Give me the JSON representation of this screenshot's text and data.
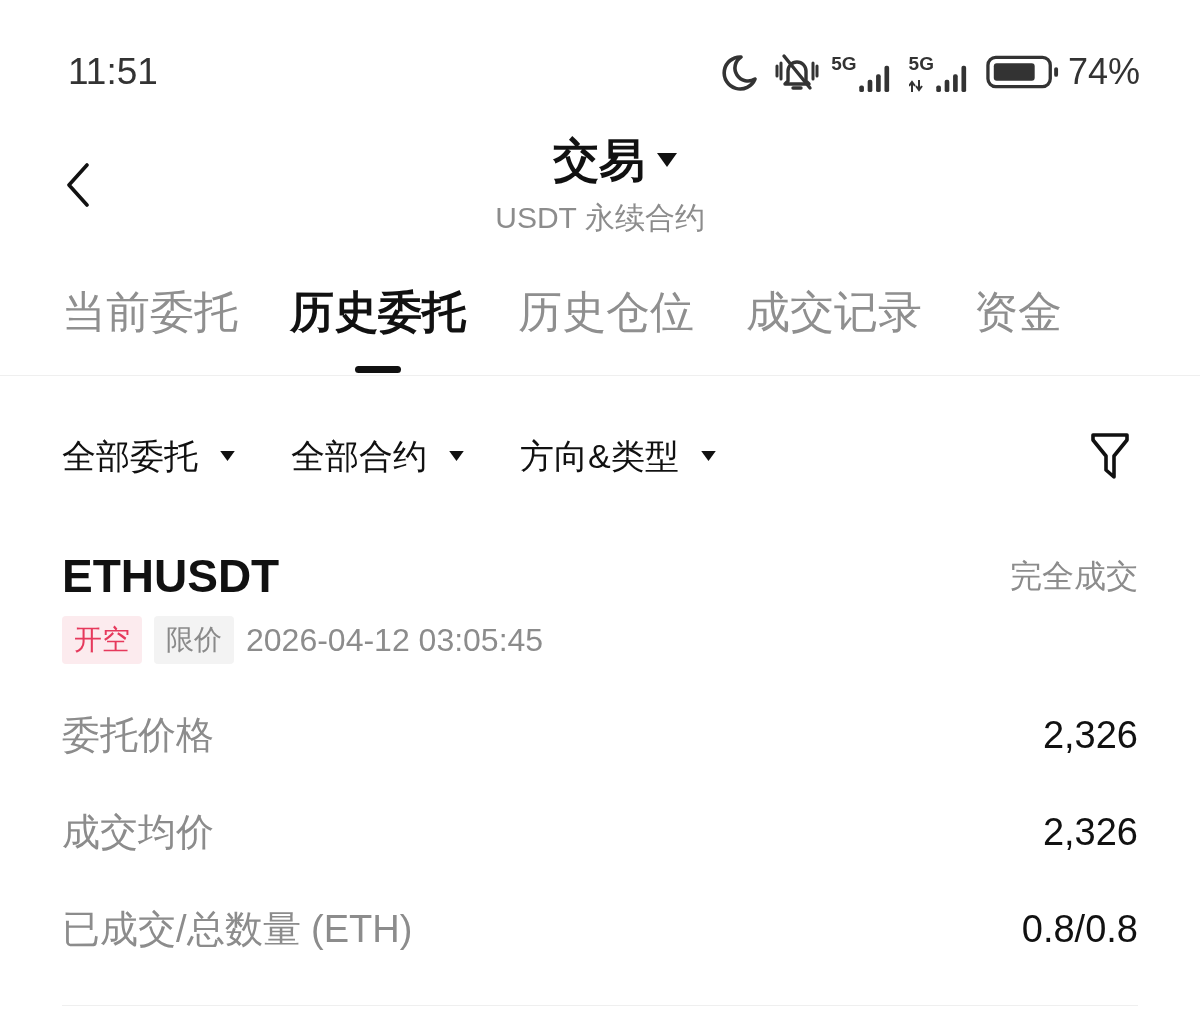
{
  "status_bar": {
    "time": "11:51",
    "networks": [
      {
        "label": "5G",
        "kind": "plain"
      },
      {
        "label": "5G",
        "kind": "transfer"
      }
    ],
    "battery": "74%"
  },
  "header": {
    "title": "交易",
    "subtitle": "USDT 永续合约"
  },
  "tabs": [
    {
      "label": "当前委托",
      "selected": false
    },
    {
      "label": "历史委托",
      "selected": true
    },
    {
      "label": "历史仓位",
      "selected": false
    },
    {
      "label": "成交记录",
      "selected": false
    },
    {
      "label": "资金",
      "selected": false
    }
  ],
  "filters": [
    "全部委托",
    "全部合约",
    "方向&类型"
  ],
  "order": {
    "symbol": "ETHUSDT",
    "status": "完全成交",
    "tags": [
      {
        "label": "开空",
        "color": "#e6395c"
      },
      {
        "label": "限价",
        "color": "#8a8a8a"
      }
    ],
    "time": "2026-04-12 03:05:45",
    "rows": [
      {
        "label": "委托价格",
        "value": "2,326"
      },
      {
        "label": "成交均价",
        "value": "2,326"
      },
      {
        "label": "已成交/总数量 (ETH)",
        "value": "0.8/0.8"
      }
    ]
  }
}
